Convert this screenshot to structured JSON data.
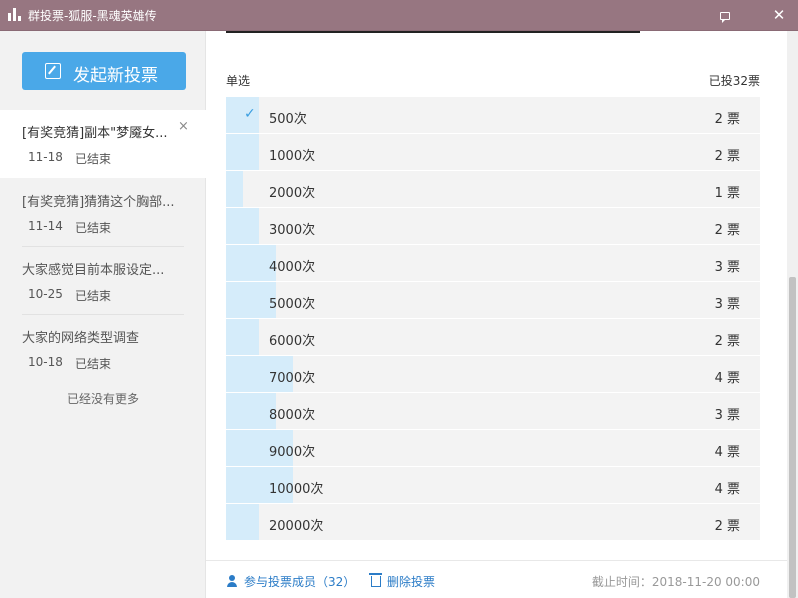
{
  "window": {
    "title": "群投票-狐服-黑魂英雄传",
    "feedback_icon": "feedback-icon",
    "close_glyph": "✕"
  },
  "sidebar": {
    "new_vote_label": "发起新投票",
    "votes": [
      {
        "title": "[有奖竞猜]副本\"梦魇女...",
        "date": "11-18",
        "status": "已结束",
        "active": true,
        "close_glyph": "×"
      },
      {
        "title": "[有奖竞猜]猜猜这个胸部...",
        "date": "11-14",
        "status": "已结束",
        "active": false
      },
      {
        "title": "大家感觉目前本服设定...",
        "date": "10-25",
        "status": "已结束",
        "active": false
      },
      {
        "title": "大家的网络类型调查",
        "date": "10-18",
        "status": "已结束",
        "active": false
      }
    ],
    "no_more": "已经没有更多"
  },
  "main": {
    "vote_type": "单选",
    "total_votes": "已投32票",
    "options": [
      {
        "label": "500次",
        "count": "2 票",
        "votes": 2,
        "selected": true
      },
      {
        "label": "1000次",
        "count": "2 票",
        "votes": 2,
        "selected": false
      },
      {
        "label": "2000次",
        "count": "1 票",
        "votes": 1,
        "selected": false
      },
      {
        "label": "3000次",
        "count": "2 票",
        "votes": 2,
        "selected": false
      },
      {
        "label": "4000次",
        "count": "3 票",
        "votes": 3,
        "selected": false
      },
      {
        "label": "5000次",
        "count": "3 票",
        "votes": 3,
        "selected": false
      },
      {
        "label": "6000次",
        "count": "2 票",
        "votes": 2,
        "selected": false
      },
      {
        "label": "7000次",
        "count": "4 票",
        "votes": 4,
        "selected": false
      },
      {
        "label": "8000次",
        "count": "3 票",
        "votes": 3,
        "selected": false
      },
      {
        "label": "9000次",
        "count": "4 票",
        "votes": 4,
        "selected": false
      },
      {
        "label": "10000次",
        "count": "4 票",
        "votes": 4,
        "selected": false
      },
      {
        "label": "20000次",
        "count": "2 票",
        "votes": 2,
        "selected": false
      }
    ],
    "check_glyph": "✓",
    "members_link": "参与投票成员（32）",
    "delete_link": "删除投票",
    "deadline": "截止时间：2018-11-20 00:00"
  },
  "colors": {
    "titlebar": "#977681",
    "accent": "#4aa8e8",
    "bar_fill": "#d5ecfa",
    "link": "#2b7cc7"
  }
}
